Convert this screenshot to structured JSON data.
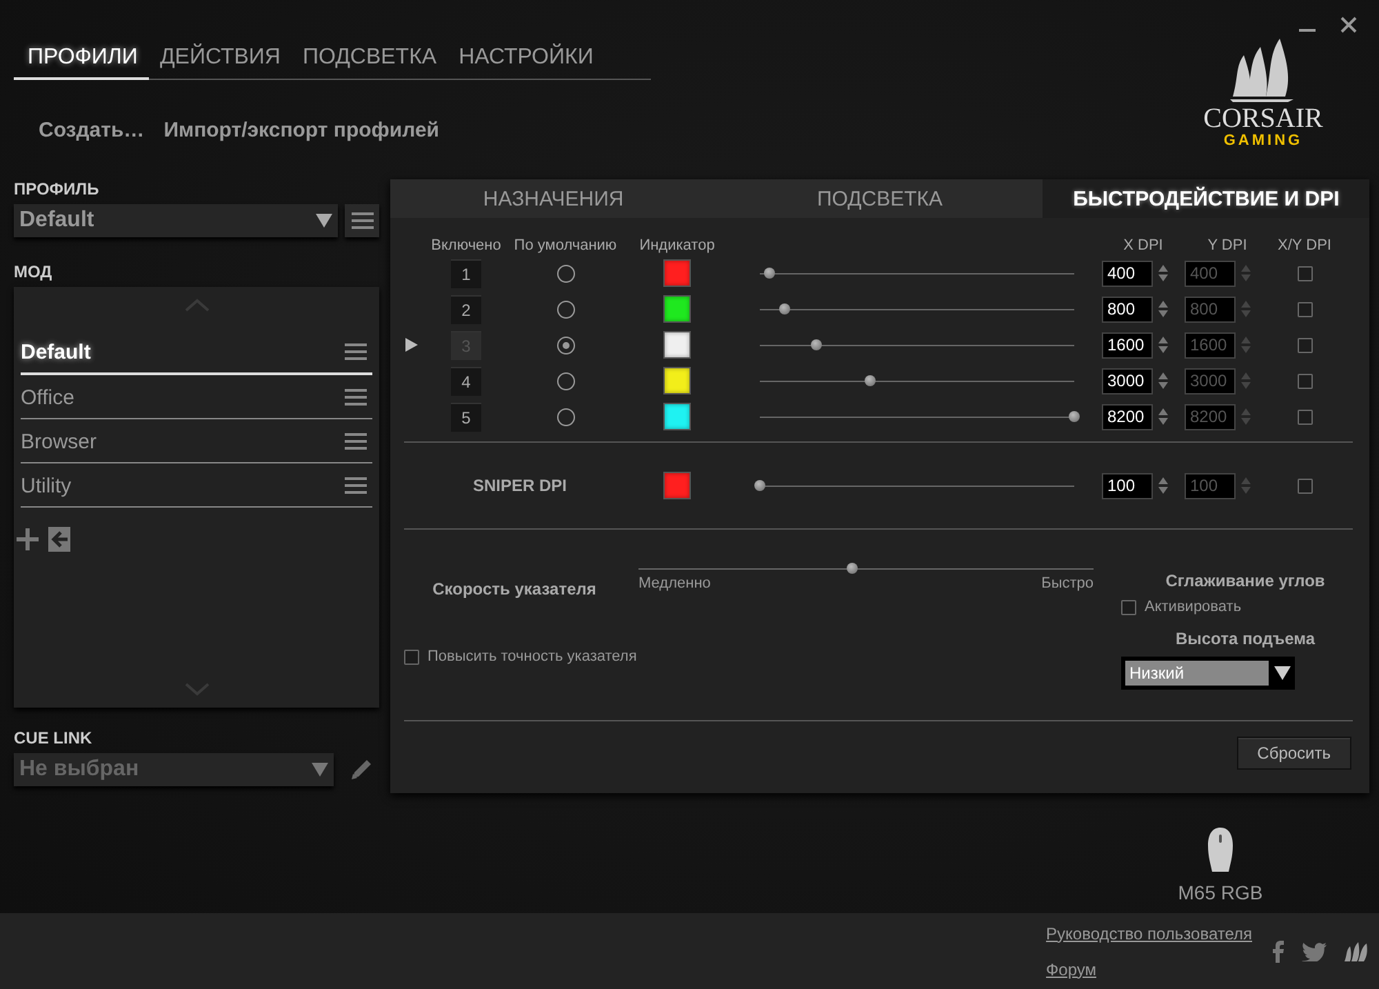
{
  "nav": {
    "tabs": [
      {
        "label": "ПРОФИЛИ",
        "selected": true
      },
      {
        "label": "ДЕЙСТВИЯ",
        "selected": false
      },
      {
        "label": "ПОДСВЕТКА",
        "selected": false
      },
      {
        "label": "НАСТРОЙКИ",
        "selected": false
      }
    ]
  },
  "actions": [
    "Создать…",
    "Импорт/экспорт профилей"
  ],
  "logo": {
    "name": "CORSAIR",
    "sub": "GAMING"
  },
  "profile": {
    "label": "ПРОФИЛЬ",
    "value": "Default"
  },
  "modes": {
    "label": "МОД",
    "items": [
      {
        "name": "Default",
        "selected": true
      },
      {
        "name": "Office",
        "selected": false
      },
      {
        "name": "Browser",
        "selected": false
      },
      {
        "name": "Utility",
        "selected": false
      }
    ]
  },
  "cue_link": {
    "label": "CUE LINK",
    "value": "Не выбран"
  },
  "panel": {
    "tabs": [
      {
        "label": "НАЗНАЧЕНИЯ",
        "selected": false
      },
      {
        "label": "ПОДСВЕТКА",
        "selected": false
      },
      {
        "label": "БЫСТРОДЕЙСТВИЕ И DPI",
        "selected": true
      }
    ],
    "columns": [
      "Включено",
      "По умолчанию",
      "Индикатор",
      "X DPI",
      "Y DPI",
      "X/Y DPI"
    ],
    "dpi_rows": [
      {
        "number": "1",
        "selected": false,
        "default": false,
        "color": "#ff1f1f",
        "level": 0.03,
        "x_dpi": "400",
        "y_dpi": "400",
        "xy_linked": false
      },
      {
        "number": "2",
        "selected": false,
        "default": false,
        "color": "#1fe81f",
        "level": 0.08,
        "x_dpi": "800",
        "y_dpi": "800",
        "xy_linked": false
      },
      {
        "number": "3",
        "selected": true,
        "default": true,
        "color": "#efefef",
        "level": 0.18,
        "x_dpi": "1600",
        "y_dpi": "1600",
        "xy_linked": false
      },
      {
        "number": "4",
        "selected": false,
        "default": false,
        "color": "#f2ee1a",
        "level": 0.35,
        "x_dpi": "3000",
        "y_dpi": "3000",
        "xy_linked": false
      },
      {
        "number": "5",
        "selected": false,
        "default": false,
        "color": "#1ff2f2",
        "level": 1,
        "x_dpi": "8200",
        "y_dpi": "8200",
        "xy_linked": false
      }
    ],
    "sniper": {
      "label": "SNIPER DPI",
      "color": "#ff1f1f",
      "level": 0,
      "x_dpi": "100",
      "y_dpi": "100",
      "xy_linked": false
    },
    "pointer_speed": {
      "label": "Скорость указателя",
      "level": 0.47,
      "min_label": "Медленно",
      "max_label": "Быстро"
    },
    "enhance_precision": {
      "label": "Повысить точность указателя",
      "checked": false
    },
    "angle_snapping": {
      "title": "Сглаживание углов",
      "label": "Активировать",
      "checked": false
    },
    "lift_height": {
      "title": "Высота подъема",
      "value": "Низкий"
    },
    "reset_button": "Сбросить"
  },
  "device": {
    "name": "M65 RGB"
  },
  "footer": {
    "links": [
      "Руководство пользователя",
      "Форум"
    ]
  }
}
